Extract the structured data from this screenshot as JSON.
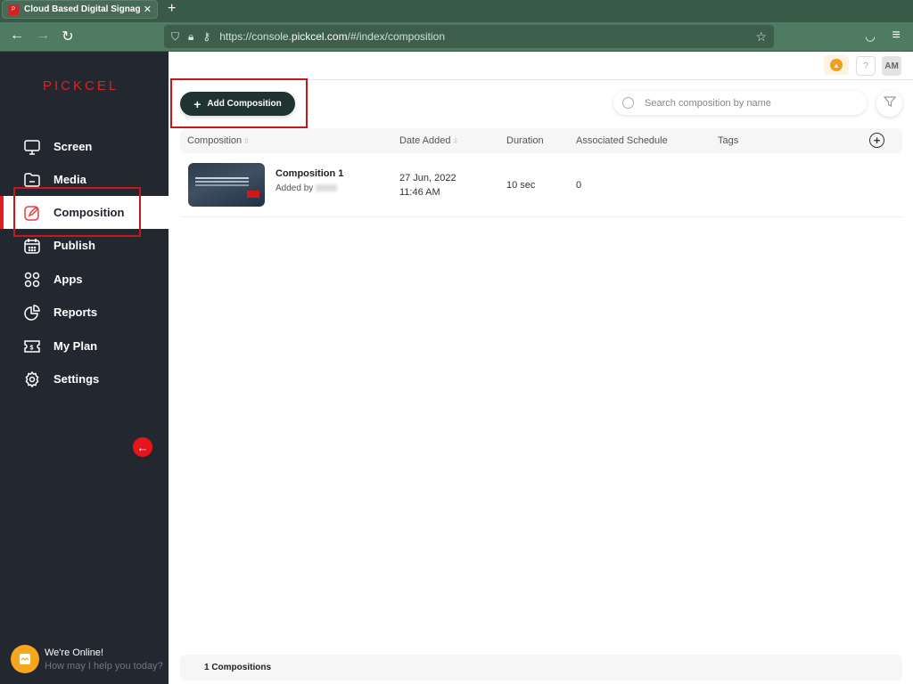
{
  "browser": {
    "tab_title": "Cloud Based Digital Signage Pro",
    "url_prefix": "https://console.",
    "url_domain": "pickcel.com",
    "url_path": "/#/index/composition"
  },
  "sidebar": {
    "logo": "PICKCEL",
    "items": [
      {
        "label": "Screen",
        "icon": "monitor-icon"
      },
      {
        "label": "Media",
        "icon": "folder-icon"
      },
      {
        "label": "Composition",
        "icon": "edit-icon",
        "active": true
      },
      {
        "label": "Publish",
        "icon": "calendar-icon"
      },
      {
        "label": "Apps",
        "icon": "grid-icon"
      },
      {
        "label": "Reports",
        "icon": "pie-chart-icon"
      },
      {
        "label": "My Plan",
        "icon": "ticket-icon"
      },
      {
        "label": "Settings",
        "icon": "gear-icon"
      }
    ],
    "chat_title": "We're Online!",
    "chat_subtitle": "How may I help you today?"
  },
  "header": {
    "help": "?",
    "avatar_initials": "AM"
  },
  "toolbar": {
    "add_label": "Add Composition",
    "search_placeholder": "Search composition by name"
  },
  "table": {
    "columns": [
      "Composition",
      "Date Added",
      "Duration",
      "Associated Schedule",
      "Tags"
    ],
    "rows": [
      {
        "name": "Composition 1",
        "added_by_label": "Added by",
        "date": "27 Jun, 2022",
        "time": "11:46 AM",
        "duration": "10 sec",
        "schedules": "0",
        "tags": ""
      }
    ]
  },
  "footer": {
    "count_label": "1 Compositions"
  },
  "colors": {
    "accent": "#e02020",
    "sidebar_bg": "#232830",
    "primary_button": "#1f3431"
  }
}
